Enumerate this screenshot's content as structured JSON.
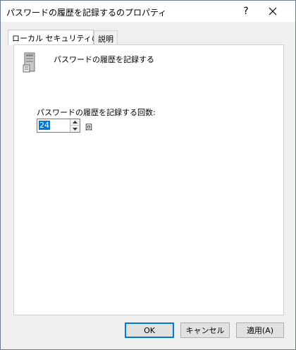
{
  "window": {
    "title": "パスワードの履歴を記録するのプロパティ",
    "help_label": "?",
    "close_label": "✕"
  },
  "tabs": [
    {
      "label": "ローカル セキュリティの設定",
      "active": true
    },
    {
      "label": "説明",
      "active": false
    }
  ],
  "policy": {
    "icon": "server-policy-icon",
    "title": "パスワードの履歴を記録する"
  },
  "setting": {
    "label": "パスワードの履歴を記録する回数:",
    "value": "24",
    "unit": "回"
  },
  "buttons": {
    "ok": "OK",
    "cancel": "キャンセル",
    "apply": "適用(A)"
  },
  "colors": {
    "accent": "#0078d7",
    "window_bg": "#f0f0f0",
    "panel_bg": "#ffffff"
  }
}
